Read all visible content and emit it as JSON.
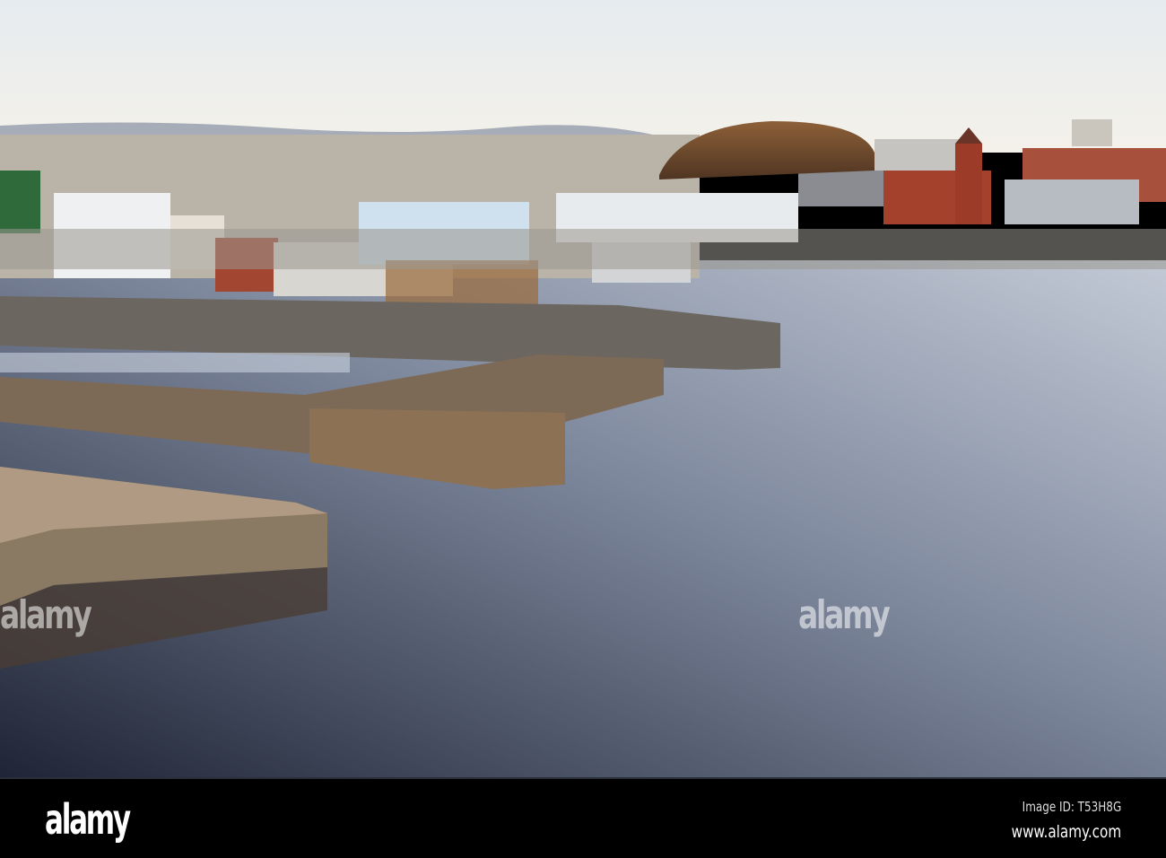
{
  "photo": {
    "subject": "Cardiff Bay waterfront at sunrise",
    "colors": {
      "sky": "#eef0f0",
      "water_light": "#b9c1cf",
      "water_dark": "#2b3245",
      "stone": "#8a7358",
      "brick": "#a9442f",
      "dome": "#7a4f2c"
    }
  },
  "watermark": {
    "text": "alamy"
  },
  "footer": {
    "logo": "alamy",
    "image_id": "Image ID: T53H8G",
    "website": "www.alamy.com"
  }
}
